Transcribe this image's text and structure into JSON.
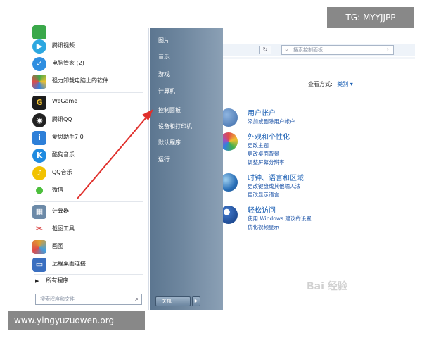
{
  "overlay": {
    "top_tag": "TG: MYYJJPP",
    "bottom_tag": "www.yingyuzuowen.org",
    "watermark": "Bai 经验"
  },
  "start_menu": {
    "programs": [
      {
        "label": "腾讯视频",
        "icon": "tencent-video-icon",
        "color": "#2ca7e0"
      },
      {
        "label": "电脑管家 (2)",
        "icon": "pc-manager-icon",
        "color": "#2f8ee0"
      },
      {
        "label": "强力卸载电脑上的软件",
        "icon": "uninstall-icon",
        "color": "#3aa84a"
      },
      {
        "label": "WeGame",
        "icon": "wegame-icon",
        "color": "#1c1c1c"
      },
      {
        "label": "腾讯QQ",
        "icon": "qq-icon",
        "color": "#222222"
      },
      {
        "label": "爱思助手7.0",
        "icon": "i4-icon",
        "color": "#2d7fd8"
      },
      {
        "label": "酷狗音乐",
        "icon": "kugou-icon",
        "color": "#1f8be0"
      },
      {
        "label": "QQ音乐",
        "icon": "qqmusic-icon",
        "color": "#f2c200"
      },
      {
        "label": "微信",
        "icon": "wechat-icon",
        "color": "#4cbf3c"
      },
      {
        "label": "计算器",
        "icon": "calculator-icon",
        "color": "#6c8aa8"
      },
      {
        "label": "截图工具",
        "icon": "snipping-tool-icon",
        "color": "#d84040"
      },
      {
        "label": "画图",
        "icon": "paint-icon",
        "color": "#e0a030"
      },
      {
        "label": "远程桌面连接",
        "icon": "remote-desktop-icon",
        "color": "#3a6fc0"
      }
    ],
    "all_programs": "所有程序",
    "search_placeholder": "搜索程序和文件",
    "right_items": [
      "图片",
      "音乐",
      "游戏",
      "计算机",
      "控制面板",
      "设备和打印机",
      "默认程序",
      "运行..."
    ],
    "shutdown_label": "关机"
  },
  "control_panel": {
    "search_placeholder": "搜索控制面板",
    "view_by_label": "查看方式:",
    "view_by_value": "类别 ▾",
    "categories": [
      {
        "title": "用户帐户",
        "links": [
          "添加或删除用户帐户"
        ],
        "color": "#4a7fc0"
      },
      {
        "title": "外观和个性化",
        "links": [
          "更改主题",
          "更改桌面背景",
          "调整屏幕分辨率"
        ],
        "color": "#c04a9a"
      },
      {
        "title": "时钟、语言和区域",
        "links": [
          "更改键盘或其他输入法",
          "更改显示语言"
        ],
        "color": "#2f8a4a"
      },
      {
        "title": "轻松访问",
        "links": [
          "使用 Windows 建议的设置",
          "优化视频显示"
        ],
        "color": "#2b5fa8"
      }
    ]
  }
}
